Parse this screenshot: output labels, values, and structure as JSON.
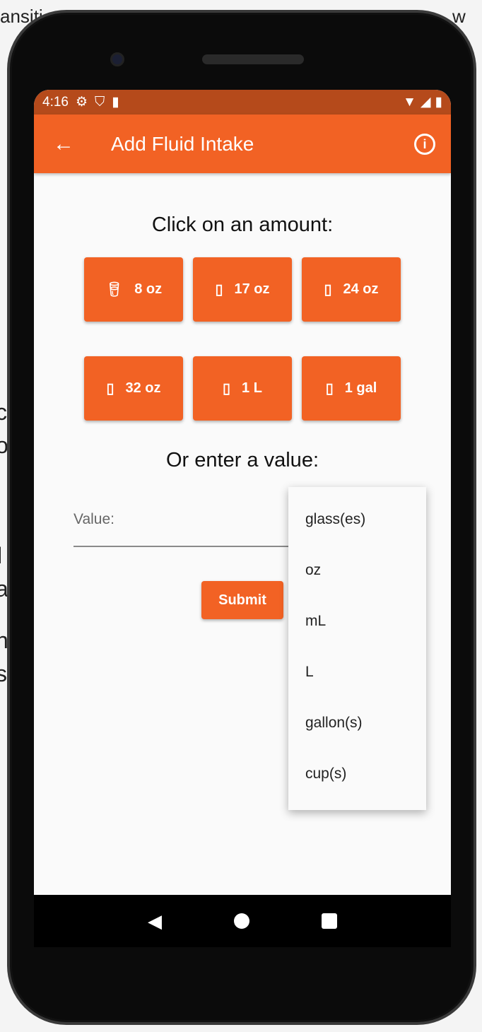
{
  "background": {
    "top_left": "ansiti",
    "top_right": "w",
    "left_chars": [
      "c",
      "o",
      "l",
      "a",
      "n",
      "s"
    ]
  },
  "status_bar": {
    "time": "4:16"
  },
  "app_bar": {
    "title": "Add Fluid Intake"
  },
  "main": {
    "heading": "Click on an amount:",
    "amounts": [
      {
        "label": "8 oz",
        "icon": "glass-icon"
      },
      {
        "label": "17 oz",
        "icon": "bottle-icon"
      },
      {
        "label": "24 oz",
        "icon": "tall-bottle-icon"
      },
      {
        "label": "32 oz",
        "icon": "sport-bottle-icon"
      },
      {
        "label": "1 L",
        "icon": "jug-icon"
      },
      {
        "label": "1 gal",
        "icon": "gallon-icon"
      }
    ],
    "subheading": "Or enter a value:",
    "value_placeholder": "Value:",
    "submit_label": "Submit"
  },
  "unit_menu": [
    "glass(es)",
    "oz",
    "mL",
    "L",
    "gallon(s)",
    "cup(s)"
  ],
  "colors": {
    "accent": "#f26224",
    "status": "#b54a1b"
  }
}
